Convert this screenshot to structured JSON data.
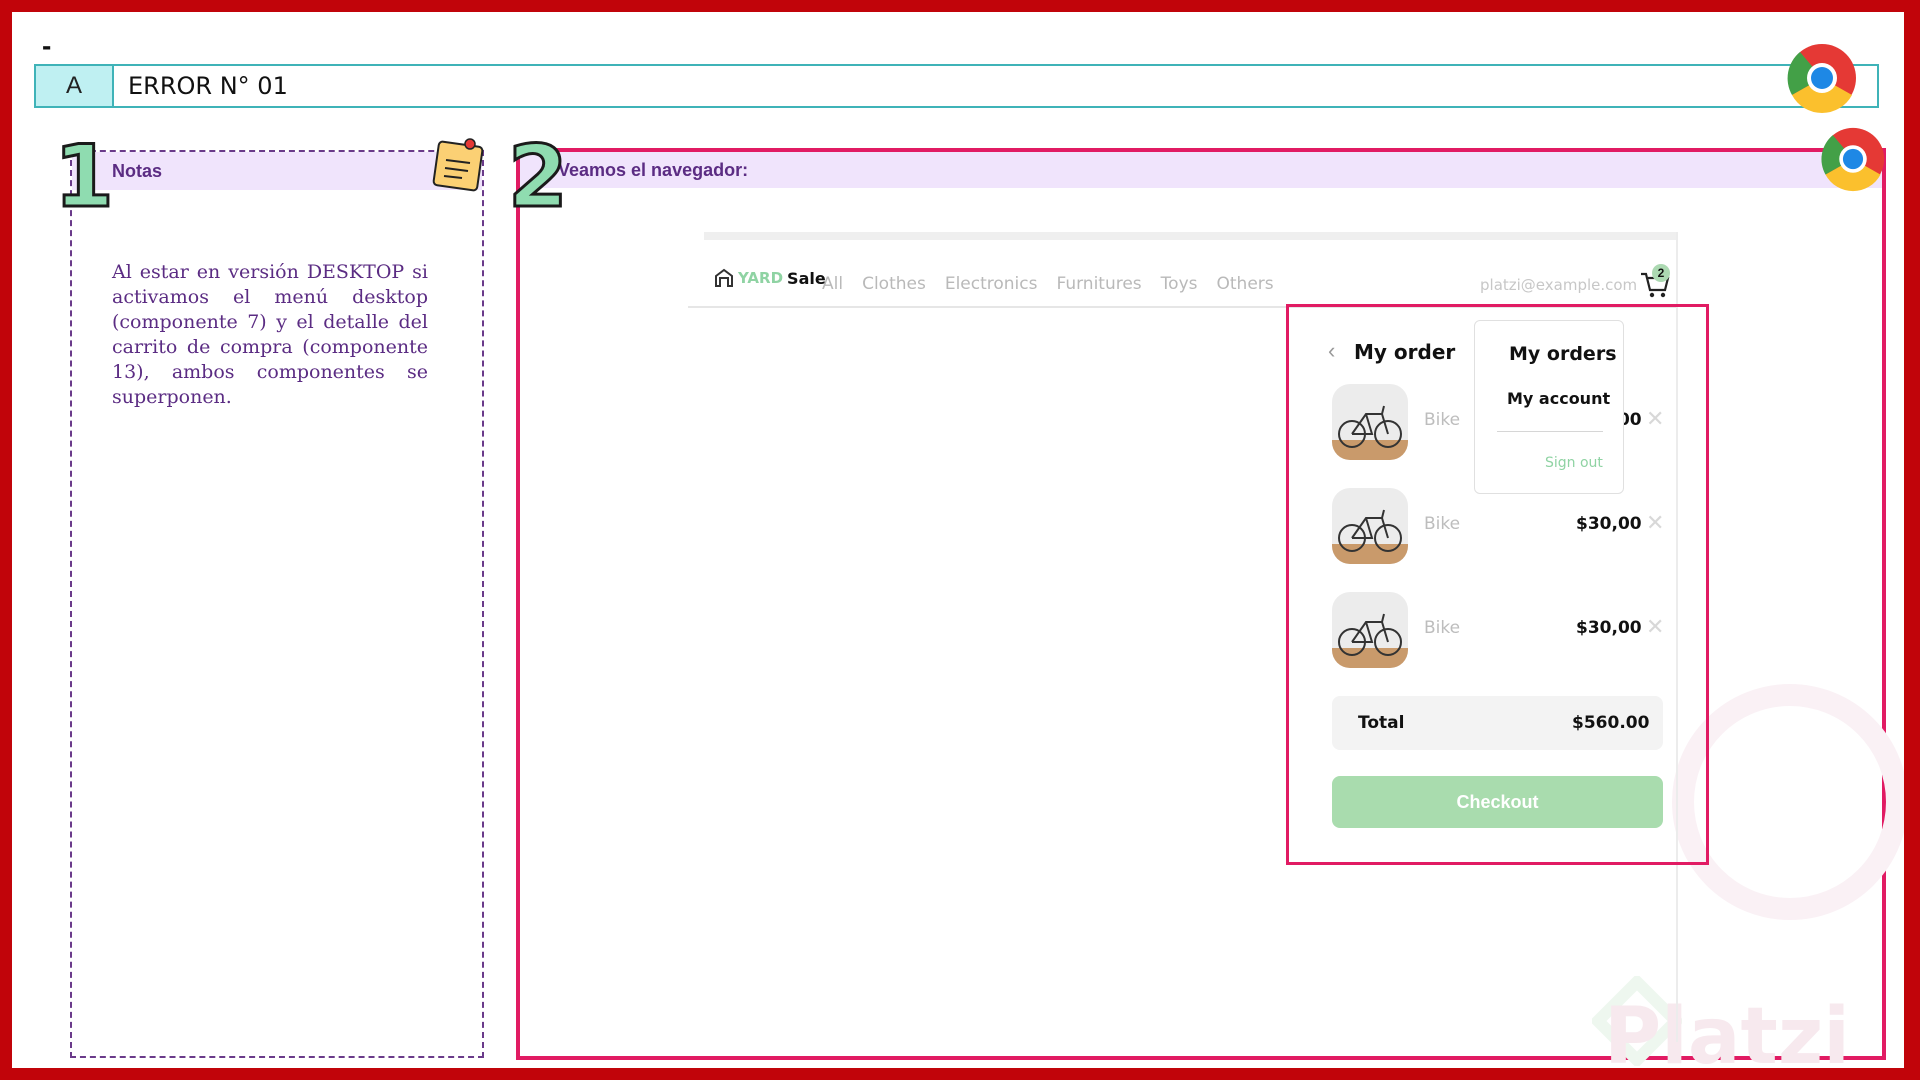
{
  "slide": {
    "dash": "-",
    "header": {
      "letter": "A",
      "title": "ERROR N° 01"
    }
  },
  "notes": {
    "number": "1",
    "title": "Notas",
    "body": "Al estar en versión DESKTOP si activamos el menú desktop (componente 7) y el detalle del carrito de compra (componente 13), ambos componentes se superponen."
  },
  "browser": {
    "number": "2",
    "title": "Veamos el navegador:"
  },
  "app": {
    "brand_yard": "YARD",
    "brand_sale": "Sale",
    "nav": [
      "All",
      "Clothes",
      "Electronics",
      "Furnitures",
      "Toys",
      "Others"
    ],
    "email": "platzi@example.com",
    "cart_count": "2"
  },
  "order": {
    "title": "My order",
    "items": [
      {
        "name": "Bike",
        "price": "$30,00"
      },
      {
        "name": "Bike",
        "price": "$30,00"
      },
      {
        "name": "Bike",
        "price": "$30,00"
      }
    ],
    "total_label": "Total",
    "total_value": "$560.00",
    "checkout_label": "Checkout"
  },
  "account_menu": {
    "orders": "My orders",
    "account": "My account",
    "signout": "Sign out"
  },
  "watermark": "Platzi",
  "colors": {
    "frame": "#c1040a",
    "highlight": "#e11b63",
    "header_border": "#3fb3b8",
    "accent_green": "#8fd3a3",
    "notes_text": "#5b2c83"
  }
}
